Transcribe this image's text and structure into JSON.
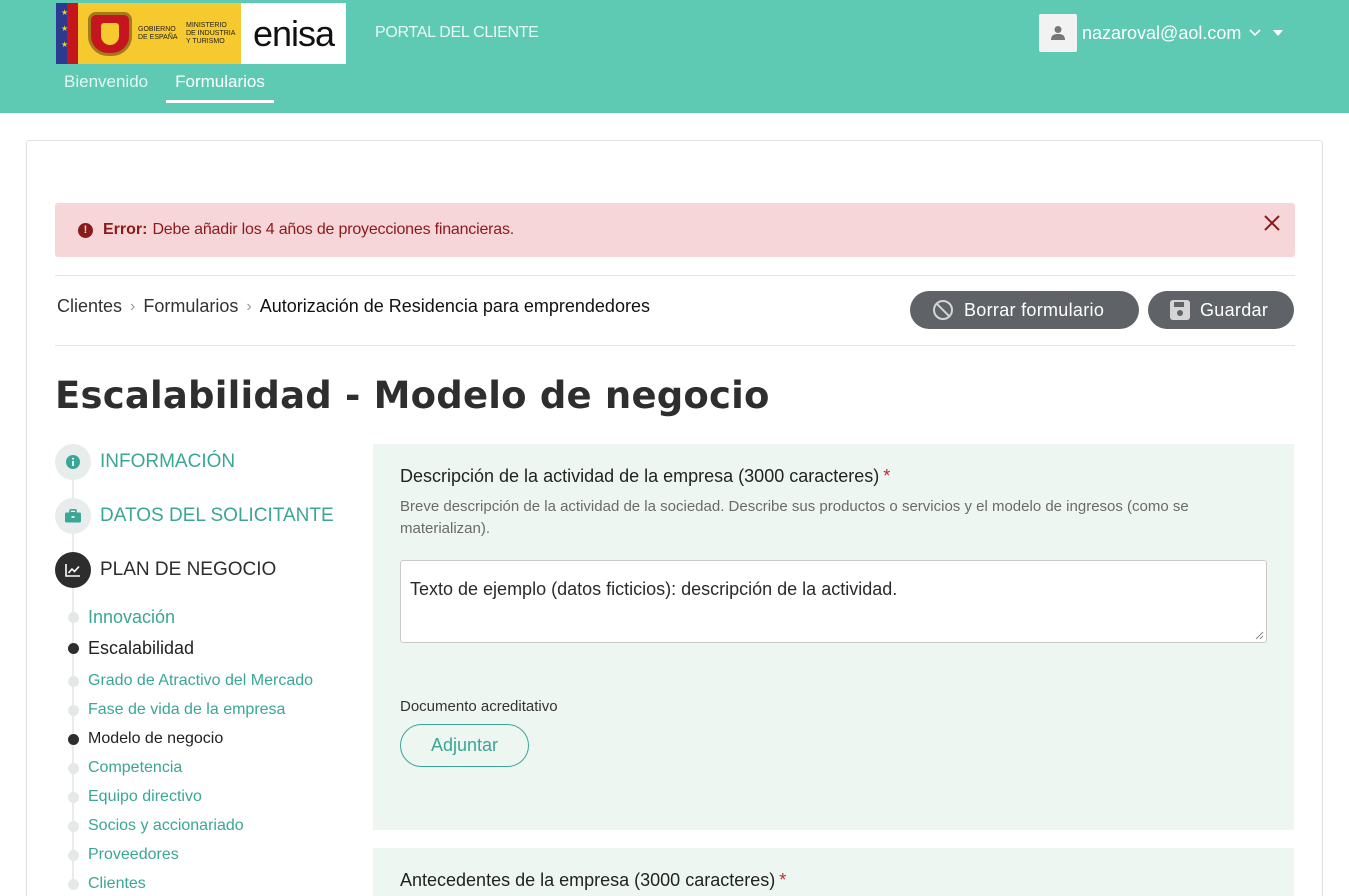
{
  "header": {
    "logo": {
      "gov_text": "GOBIERNO DE ESPAÑA",
      "ministry_text": "MINISTERIO DE INDUSTRIA Y TURISMO",
      "brand": "enisa"
    },
    "portal_title": "PORTAL DEL CLIENTE",
    "user_email": "nazaroval@aol.com",
    "nav": [
      {
        "label": "Bienvenido",
        "active": false
      },
      {
        "label": "Formularios",
        "active": true
      }
    ]
  },
  "alert": {
    "strong": "Error:",
    "message": "Debe añadir los 4 años de proyecciones financieras."
  },
  "breadcrumb": [
    "Clientes",
    "Formularios",
    "Autorización de Residencia para emprendedores"
  ],
  "actions": {
    "delete_label": "Borrar formulario",
    "save_label": "Guardar"
  },
  "page_title": "Escalabilidad - Modelo de negocio",
  "steps": [
    {
      "label": "INFORMACIÓN",
      "state": "done",
      "icon": "info-icon"
    },
    {
      "label": "DATOS DEL SOLICITANTE",
      "state": "done",
      "icon": "briefcase-icon"
    },
    {
      "label": "PLAN DE NEGOCIO",
      "state": "current",
      "icon": "chart-line-icon"
    }
  ],
  "substeps": [
    {
      "label": "Innovación",
      "state": "link"
    },
    {
      "label": "Escalabilidad",
      "state": "current"
    },
    {
      "label": "Grado de Atractivo del Mercado",
      "state": "link"
    },
    {
      "label": "Fase de vida de la empresa",
      "state": "link"
    },
    {
      "label": "Modelo de negocio",
      "state": "current"
    },
    {
      "label": "Competencia",
      "state": "link"
    },
    {
      "label": "Equipo directivo",
      "state": "link"
    },
    {
      "label": "Socios y accionariado",
      "state": "link"
    },
    {
      "label": "Proveedores",
      "state": "link"
    },
    {
      "label": "Clientes",
      "state": "link"
    }
  ],
  "form": {
    "field1": {
      "label": "Descripción de la actividad de la empresa (3000 caracteres)",
      "required_mark": "*",
      "help": "Breve descripción de la actividad de la sociedad. Describe sus productos o servicios y el modelo de ingresos (como se materializan).",
      "value": "Texto de ejemplo (datos ficticios): descripción de la actividad."
    },
    "document_label": "Documento acreditativo",
    "attach_label": "Adjuntar",
    "field2": {
      "label": "Antecedentes de la empresa (3000 caracteres)",
      "required_mark": "*"
    }
  },
  "colors": {
    "header_bg": "#5ecab3",
    "accent": "#3aa696",
    "alert_bg": "#f6d6d9",
    "alert_text": "#8b1a1a",
    "panel_bg": "#eef6f2",
    "button_dark": "#5f6368"
  }
}
